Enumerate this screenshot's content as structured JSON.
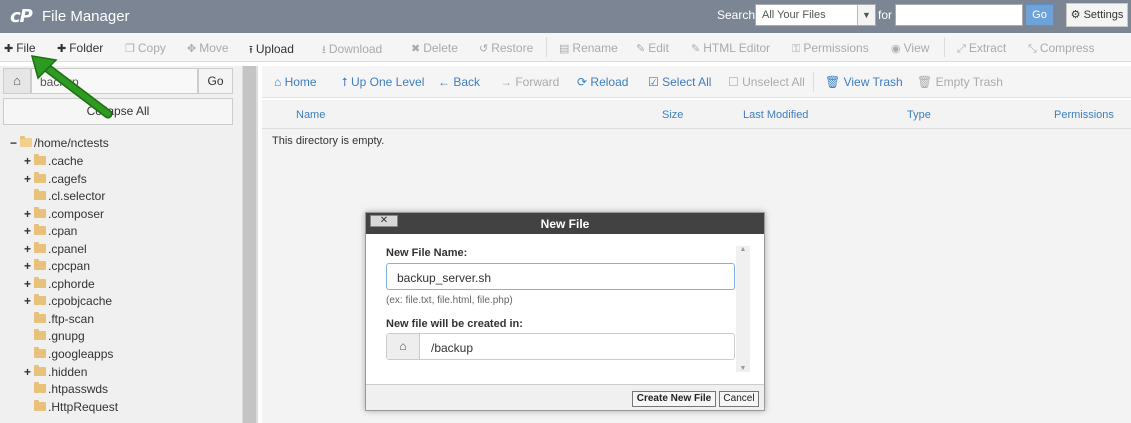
{
  "header": {
    "logo": "cP",
    "title": "File Manager",
    "search_label": "Search",
    "search_scope": "All Your Files",
    "for_label": "for",
    "search_value": "",
    "go_label": "Go",
    "settings_label": "Settings"
  },
  "toolbar": {
    "items": [
      {
        "label": "File",
        "icon": "plus-icon"
      },
      {
        "label": "Folder",
        "icon": "plus-icon"
      },
      {
        "label": "Copy",
        "icon": "copy-icon"
      },
      {
        "label": "Move",
        "icon": "move-icon"
      },
      {
        "label": "Upload",
        "icon": "upload-icon"
      },
      {
        "label": "Download",
        "icon": "download-icon"
      },
      {
        "label": "Delete",
        "icon": "delete-icon"
      },
      {
        "label": "Restore",
        "icon": "restore-icon"
      },
      {
        "label": "Rename",
        "icon": "rename-icon"
      },
      {
        "label": "Edit",
        "icon": "edit-icon"
      },
      {
        "label": "HTML Editor",
        "icon": "html-editor-icon"
      },
      {
        "label": "Permissions",
        "icon": "key-icon"
      },
      {
        "label": "View",
        "icon": "eye-icon"
      },
      {
        "label": "Extract",
        "icon": "extract-icon"
      },
      {
        "label": "Compress",
        "icon": "compress-icon"
      }
    ]
  },
  "left_panel": {
    "path_value": "backup",
    "go_label": "Go",
    "collapse_label": "Collapse All",
    "root": "/home/nctests",
    "folders": [
      {
        "name": ".cache",
        "expandable": true
      },
      {
        "name": ".cagefs",
        "expandable": true
      },
      {
        "name": ".cl.selector",
        "expandable": false
      },
      {
        "name": ".composer",
        "expandable": true
      },
      {
        "name": ".cpan",
        "expandable": true
      },
      {
        "name": ".cpanel",
        "expandable": true
      },
      {
        "name": ".cpcpan",
        "expandable": true
      },
      {
        "name": ".cphorde",
        "expandable": true
      },
      {
        "name": ".cpobjcache",
        "expandable": true
      },
      {
        "name": ".ftp-scan",
        "expandable": false
      },
      {
        "name": ".gnupg",
        "expandable": false
      },
      {
        "name": ".googleapps",
        "expandable": false
      },
      {
        "name": ".hidden",
        "expandable": true
      },
      {
        "name": ".htpasswds",
        "expandable": false
      },
      {
        "name": ".HttpRequest",
        "expandable": false
      }
    ]
  },
  "nav": {
    "items": [
      {
        "label": "Home",
        "icon": "home-icon",
        "enabled": true
      },
      {
        "label": "Up One Level",
        "icon": "up-level-icon",
        "enabled": true
      },
      {
        "label": "Back",
        "icon": "back-arrow-icon",
        "enabled": true
      },
      {
        "label": "Forward",
        "icon": "forward-arrow-icon",
        "enabled": false
      },
      {
        "label": "Reload",
        "icon": "reload-icon",
        "enabled": true
      },
      {
        "label": "Select All",
        "icon": "checkbox-checked-icon",
        "enabled": true
      },
      {
        "label": "Unselect All",
        "icon": "checkbox-empty-icon",
        "enabled": false
      },
      {
        "label": "View Trash",
        "icon": "trash-icon",
        "enabled": true
      },
      {
        "label": "Empty Trash",
        "icon": "trash-icon",
        "enabled": false
      }
    ]
  },
  "file_list": {
    "columns": [
      "Name",
      "Size",
      "Last Modified",
      "Type",
      "Permissions"
    ],
    "empty_message": "This directory is empty."
  },
  "dialog": {
    "title": "New File",
    "close_label": "✕",
    "file_name_label": "New File Name:",
    "file_name_value": "backup_server.sh",
    "hint": "(ex: file.txt, file.html, file.php)",
    "location_label": "New file will be created in:",
    "location_value": "/backup",
    "create_label": "Create New File",
    "cancel_label": "Cancel"
  },
  "colors": {
    "header_bg": "#7b8593",
    "link_blue": "#3d7ec1",
    "arrow_green": "#2f8f1f",
    "dialog_title_bg": "#424242"
  }
}
